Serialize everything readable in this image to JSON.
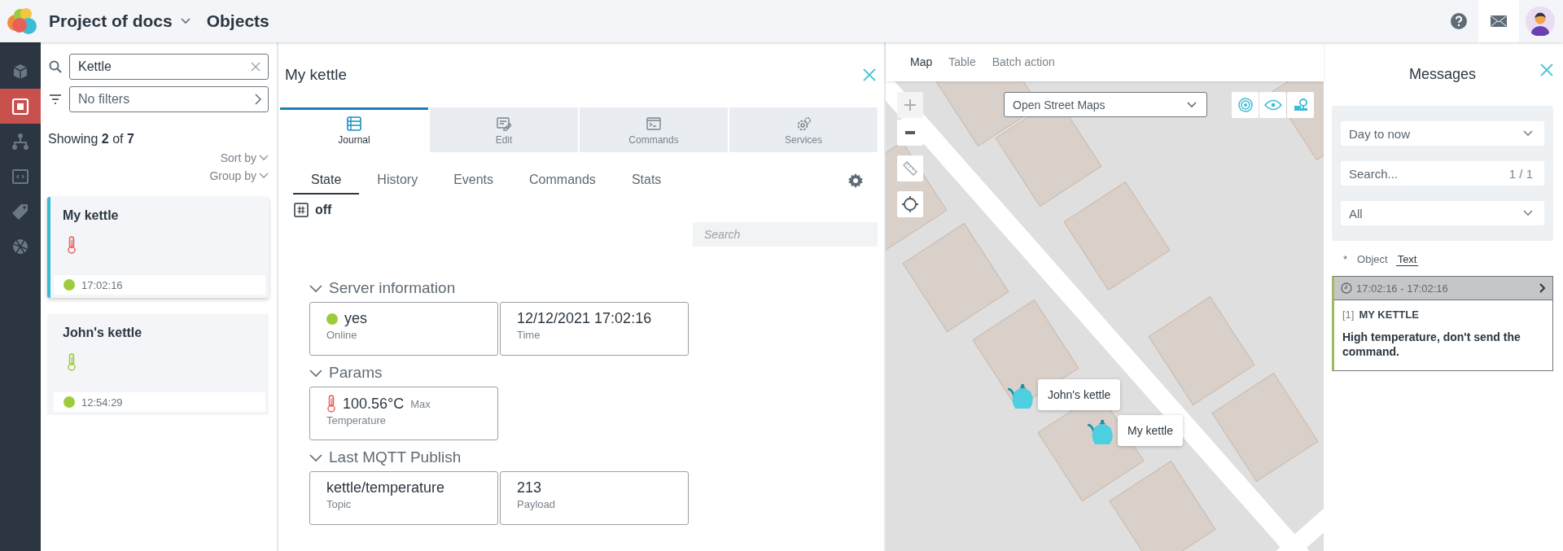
{
  "header": {
    "project": "Project of docs",
    "section": "Objects"
  },
  "nav": [
    {
      "kind": "cube",
      "selected": false
    },
    {
      "kind": "devices",
      "selected": true
    },
    {
      "kind": "hierarchy",
      "selected": false
    },
    {
      "kind": "code",
      "selected": false
    },
    {
      "kind": "tag",
      "selected": false
    },
    {
      "kind": "globe",
      "selected": false
    }
  ],
  "object_list": {
    "search": {
      "value": "Kettle"
    },
    "filter": {
      "value": "No filters"
    },
    "showing": "Showing **2** of **7**",
    "sort_by": "Sort by",
    "group_by": "Group by",
    "items": [
      {
        "name": "My kettle",
        "color": "#e8605a",
        "online": true,
        "time": "17:02:16",
        "selected": true
      },
      {
        "name": "John's kettle",
        "color": "#9ccc3c",
        "online": true,
        "time": "12:54:29",
        "selected": false
      }
    ]
  },
  "details": {
    "title": "My kettle",
    "tabs": [
      {
        "kind": "journal",
        "label": "Journal",
        "selected": true
      },
      {
        "kind": "edit",
        "label": "Edit",
        "selected": false
      },
      {
        "kind": "commands",
        "label": "Commands",
        "selected": false
      },
      {
        "kind": "services",
        "label": "Services",
        "selected": false
      }
    ],
    "subtabs": [
      {
        "label": "State",
        "selected": true
      },
      {
        "label": "History",
        "selected": false
      },
      {
        "label": "Events",
        "selected": false
      },
      {
        "label": "Commands",
        "selected": false
      },
      {
        "label": "Stats",
        "selected": false
      }
    ],
    "state": "off",
    "search": {
      "placeholder": "Search"
    },
    "sections": [
      {
        "title": "Server information",
        "expanded": true,
        "fields": [
          {
            "kind": "status",
            "online": true,
            "value": "yes",
            "label": "Online"
          },
          {
            "kind": "plain",
            "value": "12/12/2021 17:02:16",
            "label": "Time"
          }
        ]
      },
      {
        "title": "Params",
        "expanded": true,
        "fields": [
          {
            "kind": "temperature",
            "color": "#e8605a",
            "value": "100.56°C",
            "note": "Max",
            "label": "Temperature"
          }
        ]
      },
      {
        "title": "Last MQTT Publish",
        "expanded": true,
        "fields": [
          {
            "kind": "plain",
            "value": "kettle/temperature",
            "label": "Topic"
          },
          {
            "kind": "plain",
            "value": "213",
            "label": "Payload"
          }
        ]
      }
    ]
  },
  "map": {
    "tabs": [
      {
        "label": "Map",
        "selected": true
      },
      {
        "label": "Table",
        "selected": false
      },
      {
        "label": "Batch action",
        "selected": false
      }
    ],
    "layer": "Open Street Maps",
    "markers": [
      {
        "label": "John's kettle"
      },
      {
        "label": "My kettle"
      }
    ]
  },
  "messages": {
    "title": "Messages",
    "period": "Day to now",
    "search": {
      "placeholder": "Search..."
    },
    "count": "1 / 1",
    "filter": "All",
    "columns": [
      {
        "label": "*",
        "selected": false
      },
      {
        "label": "Object",
        "selected": false
      },
      {
        "label": "Text",
        "selected": true
      }
    ],
    "items": [
      {
        "time": "17:02:16 - 17:02:16",
        "index": "[1]",
        "object": "MY KETTLE",
        "text": "High temperature, don't send the command."
      }
    ]
  }
}
